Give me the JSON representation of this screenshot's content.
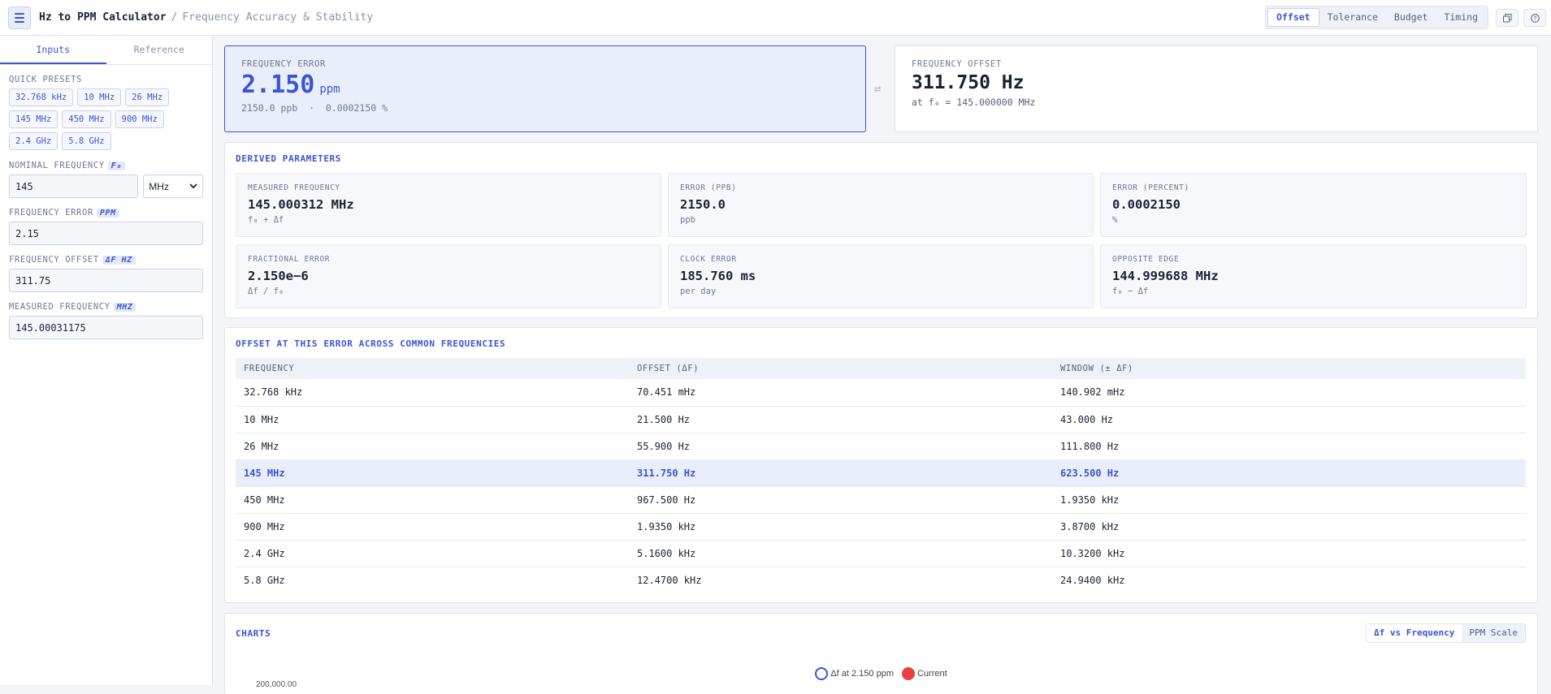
{
  "header": {
    "title": "Hz to PPM Calculator",
    "separator": "/",
    "subtitle": "Frequency Accuracy & Stability",
    "modes": [
      "Offset",
      "Tolerance",
      "Budget",
      "Timing"
    ],
    "active_mode": "Offset",
    "icons": [
      "menu-icon",
      "copy-icon",
      "help-icon"
    ]
  },
  "sidebar": {
    "tabs": [
      "Inputs",
      "Reference"
    ],
    "active_tab": "Inputs",
    "presets_label": "QUICK PRESETS",
    "presets": [
      "32.768 kHz",
      "10 MHz",
      "26 MHz",
      "145 MHz",
      "450 MHz",
      "900 MHz",
      "2.4 GHz",
      "5.8 GHz"
    ],
    "nominal": {
      "label": "NOMINAL FREQUENCY",
      "tag": "F₀",
      "value": "145",
      "unit": "MHz"
    },
    "error": {
      "label": "FREQUENCY ERROR",
      "tag": "PPM",
      "value": "2.15"
    },
    "offset": {
      "label": "FREQUENCY OFFSET",
      "tag": "ΔF HZ",
      "value": "311.75"
    },
    "measured": {
      "label": "MEASURED FREQUENCY",
      "tag": "MHZ",
      "value": "145.00031175"
    }
  },
  "hero": {
    "error_label": "FREQUENCY ERROR",
    "error_value": "2.150",
    "error_unit": "ppm",
    "error_sub": "2150.0 ppb  ·  0.0002150 %",
    "swap_icon": "swap-icon",
    "offset_label": "FREQUENCY OFFSET",
    "offset_value": "311.750 Hz",
    "offset_sub": "at f₀ = 145.000000 MHz"
  },
  "derived": {
    "title": "DERIVED PARAMETERS",
    "items": [
      {
        "label": "MEASURED FREQUENCY",
        "value": "145.000312 MHz",
        "hint": "f₀ + Δf"
      },
      {
        "label": "ERROR (PPB)",
        "value": "2150.0",
        "hint": "ppb"
      },
      {
        "label": "ERROR (PERCENT)",
        "value": "0.0002150",
        "hint": "%"
      },
      {
        "label": "FRACTIONAL ERROR",
        "value": "2.150e−6",
        "hint": "Δf / f₀"
      },
      {
        "label": "CLOCK ERROR",
        "value": "185.760 ms",
        "hint": "per day"
      },
      {
        "label": "OPPOSITE EDGE",
        "value": "144.999688 MHz",
        "hint": "f₀ − Δf"
      }
    ]
  },
  "table": {
    "title": "OFFSET AT THIS ERROR ACROSS COMMON FREQUENCIES",
    "columns": [
      "FREQUENCY",
      "OFFSET (ΔF)",
      "WINDOW (± ΔF)"
    ],
    "rows": [
      [
        "32.768 kHz",
        "70.451 mHz",
        "140.902 mHz"
      ],
      [
        "10 MHz",
        "21.500 Hz",
        "43.000 Hz"
      ],
      [
        "26 MHz",
        "55.900 Hz",
        "111.800 Hz"
      ],
      [
        "145 MHz",
        "311.750 Hz",
        "623.500 Hz"
      ],
      [
        "450 MHz",
        "967.500 Hz",
        "1.9350 kHz"
      ],
      [
        "900 MHz",
        "1.9350 kHz",
        "3.8700 kHz"
      ],
      [
        "2.4 GHz",
        "5.1600 kHz",
        "10.3200 kHz"
      ],
      [
        "5.8 GHz",
        "12.4700 kHz",
        "24.9400 kHz"
      ]
    ],
    "current_row": 3
  },
  "charts": {
    "title": "CHARTS",
    "toggles": [
      "Δf vs Frequency",
      "PPM Scale"
    ],
    "active_toggle": "Δf vs Frequency",
    "legend": [
      "Δf at 2.150 ppm",
      "Current"
    ],
    "axis_partial": "200,000.00",
    "colors": {
      "series": "#3a56d4",
      "current": "#e8423f"
    }
  }
}
